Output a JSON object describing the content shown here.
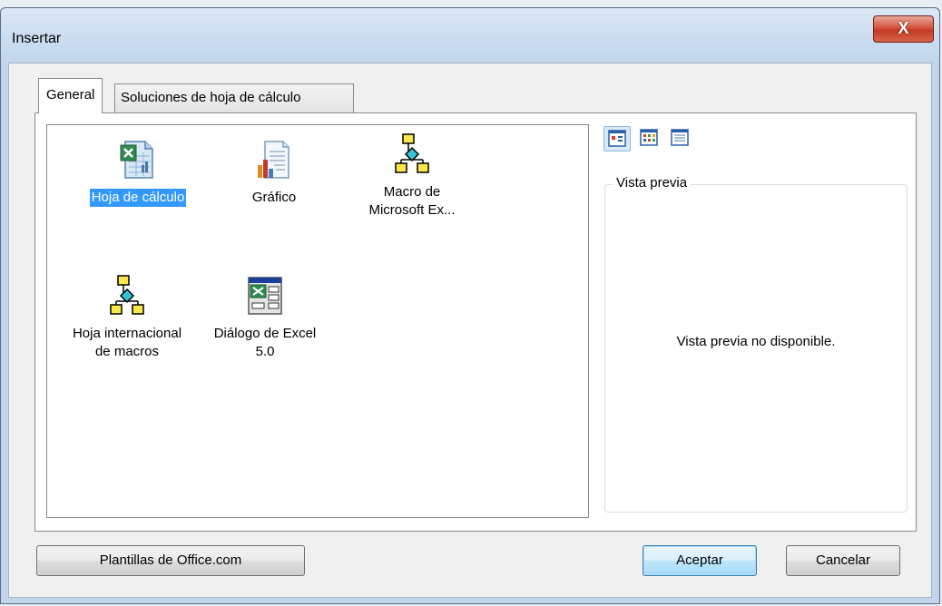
{
  "window": {
    "title": "Insertar",
    "close_label": "X"
  },
  "tabs": [
    {
      "label": "General",
      "active": true
    },
    {
      "label": "Soluciones de hoja de cálculo",
      "active": false
    }
  ],
  "items": [
    {
      "label": "Hoja de cálculo",
      "icon": "excel-worksheet-icon",
      "selected": true
    },
    {
      "label": "Gráfico",
      "icon": "chart-document-icon",
      "selected": false
    },
    {
      "label_line1": "Macro de",
      "label_line2": "Microsoft Ex...",
      "icon": "macro-flowchart-icon",
      "selected": false
    },
    {
      "label_line1": "Hoja internacional",
      "label_line2": "de macros",
      "icon": "macro-flowchart-icon",
      "selected": false
    },
    {
      "label_line1": "Diálogo de Excel",
      "label_line2": "5.0",
      "icon": "excel-dialog-icon",
      "selected": false
    }
  ],
  "view_buttons": [
    {
      "icon": "large-icons-view-icon",
      "pressed": true
    },
    {
      "icon": "list-view-icon",
      "pressed": false
    },
    {
      "icon": "details-view-icon",
      "pressed": false
    }
  ],
  "preview": {
    "title": "Vista previa",
    "message": "Vista previa no disponible."
  },
  "buttons": {
    "templates": "Plantillas de Office.com",
    "ok": "Aceptar",
    "cancel": "Cancelar"
  },
  "colors": {
    "selection": "#3399ff",
    "close_button": "#c13a22"
  }
}
